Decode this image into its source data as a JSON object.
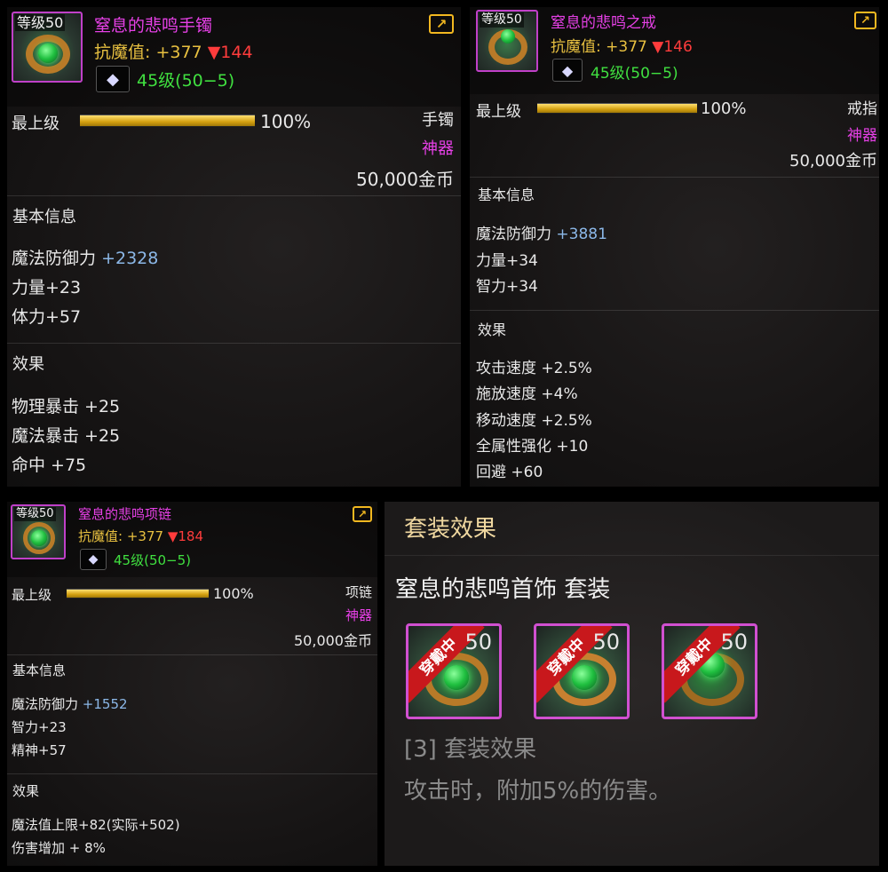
{
  "items": [
    {
      "level_tag": "等级50",
      "name": "窒息的悲鸣手镯",
      "resist_label": "抗魔值:",
      "resist_up": "+377",
      "resist_down": "▼144",
      "gem_text": "45级(50−5)",
      "rank_label": "最上级",
      "rank_pct": "100%",
      "rank_value": 100,
      "slot": "手镯",
      "rarity": "神器",
      "price": "50,000金币",
      "basic_header": "基本信息",
      "basic": [
        {
          "name": "魔法防御力",
          "value": "+2328"
        },
        {
          "name": "力量+23",
          "value": ""
        },
        {
          "name": "体力+57",
          "value": ""
        }
      ],
      "effect_header": "效果",
      "effects": [
        "物理暴击 +25",
        "魔法暴击 +25",
        "命中 +75"
      ]
    },
    {
      "level_tag": "等级50",
      "name": "窒息的悲鸣之戒",
      "resist_label": "抗魔值:",
      "resist_up": "+377",
      "resist_down": "▼146",
      "gem_text": "45级(50−5)",
      "rank_label": "最上级",
      "rank_pct": "100%",
      "rank_value": 100,
      "slot": "戒指",
      "rarity": "神器",
      "price": "50,000金币",
      "basic_header": "基本信息",
      "basic": [
        {
          "name": "魔法防御力",
          "value": "+3881"
        },
        {
          "name": "力量+34",
          "value": ""
        },
        {
          "name": "智力+34",
          "value": ""
        }
      ],
      "effect_header": "效果",
      "effects": [
        "攻击速度 +2.5%",
        "施放速度 +4%",
        "移动速度 +2.5%",
        "全属性强化 +10",
        "回避 +60"
      ]
    },
    {
      "level_tag": "等级50",
      "name": "窒息的悲鸣项链",
      "resist_label": "抗魔值:",
      "resist_up": "+377",
      "resist_down": "▼184",
      "gem_text": "45级(50−5)",
      "rank_label": "最上级",
      "rank_pct": "100%",
      "rank_value": 100,
      "slot": "项链",
      "rarity": "神器",
      "price": "50,000金币",
      "basic_header": "基本信息",
      "basic": [
        {
          "name": "魔法防御力",
          "value": "+1552"
        },
        {
          "name": "智力+23",
          "value": ""
        },
        {
          "name": "精神+57",
          "value": ""
        }
      ],
      "effect_header": "效果",
      "effects": [
        "魔法值上限+82(实际+502)",
        "伤害增加 + 8%"
      ]
    }
  ],
  "set_panel": {
    "title": "套装效果",
    "set_name": "窒息的悲鸣首饰 套装",
    "icons": [
      {
        "ribbon": "穿戴中",
        "level": "50",
        "icon": "necklace-icon"
      },
      {
        "ribbon": "穿戴中",
        "level": "50",
        "icon": "bracelet-icon"
      },
      {
        "ribbon": "穿戴中",
        "level": "50",
        "icon": "ring-icon"
      }
    ],
    "bonus_header": "[3] 套装效果",
    "bonus_text": "攻击时，附加5%的伤害。"
  },
  "colors": {
    "item_name": "#e640e6",
    "resist": "#e8c040",
    "resist_down": "#ff3c3c",
    "gem_text": "#40e040",
    "bar_fill": "#d4a010",
    "stat_value": "#8cb8e8",
    "ribbon": "#c8181c",
    "frame": "#d050d0"
  }
}
